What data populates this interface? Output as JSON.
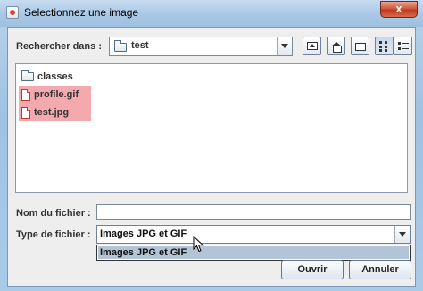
{
  "window": {
    "title": "Selectionnez une image",
    "close_label": "x"
  },
  "lookin": {
    "label": "Rechercher dans :",
    "current_folder": "test"
  },
  "toolbar": {
    "buttons": [
      "up-one-level",
      "home",
      "new-folder",
      "list-view",
      "details-view"
    ],
    "pressed": "list-view"
  },
  "files": [
    {
      "name": "classes",
      "type": "folder",
      "selected": false
    },
    {
      "name": "profile.gif",
      "type": "file",
      "selected": true
    },
    {
      "name": "test.jpg",
      "type": "file",
      "selected": true
    }
  ],
  "filename": {
    "label": "Nom du fichier :",
    "value": ""
  },
  "filetype": {
    "label": "Type de fichier :",
    "selected": "Images JPG et GIF",
    "options": [
      "Images JPG et GIF"
    ]
  },
  "buttons": {
    "open": "Ouvrir",
    "cancel": "Annuler"
  },
  "colors": {
    "selection": "#f3a9ad",
    "popup_highlight": "#b3c4d6",
    "background": "#eeeeee"
  }
}
